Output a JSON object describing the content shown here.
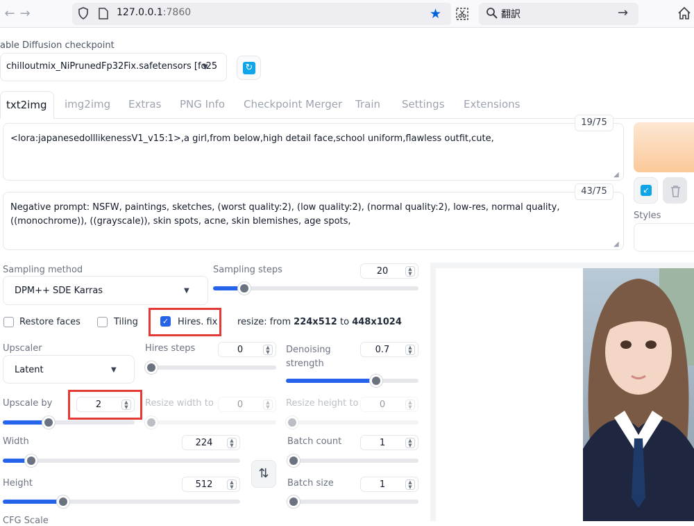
{
  "browser": {
    "url_host": "127.0.0.1",
    "url_port": ":7860",
    "search_text": "翻訳"
  },
  "checkpoint": {
    "label": "able Diffusion checkpoint",
    "value": "chilloutmix_NiPrunedFp32Fix.safetensors [fc25"
  },
  "tabs": [
    "txt2img",
    "img2img",
    "Extras",
    "PNG Info",
    "Checkpoint Merger",
    "Train",
    "Settings",
    "Extensions"
  ],
  "prompt": {
    "text": "<lora:japanesedolllikenessV1_v15:1>,a girl,from below,high detail face,school uniform,flawless outfit,cute,",
    "counter": "19/75"
  },
  "negative_prompt": {
    "text": "Negative prompt: NSFW, paintings, sketches, (worst quality:2), (low quality:2), (normal quality:2), low-res, normal quality, ((monochrome)), ((grayscale)), skin spots, acne, skin blemishes, age spots,",
    "counter": "43/75"
  },
  "styles_label": "Styles",
  "sampling": {
    "method_label": "Sampling method",
    "method_value": "DPM++ SDE Karras",
    "steps_label": "Sampling steps",
    "steps_value": "20",
    "steps_fraction": 0.13
  },
  "options": {
    "restore_faces": "Restore faces",
    "tiling": "Tiling",
    "hires_fix": "Hires. fix",
    "resize_prefix": "resize: from",
    "resize_from": "224x512",
    "resize_to_word": "to",
    "resize_to": "448x1024"
  },
  "hires": {
    "upscaler_label": "Upscaler",
    "upscaler_value": "Latent",
    "steps_label": "Hires steps",
    "steps_value": "0",
    "steps_fraction": 0.0,
    "denoise_label_1": "Denoising",
    "denoise_label_2": "strength",
    "denoise_value": "0.7",
    "denoise_fraction": 0.7,
    "upscale_label": "Upscale by",
    "upscale_value": "2",
    "upscale_fraction": 0.33,
    "resize_w_label": "Resize width to",
    "resize_w_value": "0",
    "resize_h_label": "Resize height to",
    "resize_h_value": "0"
  },
  "size": {
    "width_label": "Width",
    "width_value": "224",
    "width_fraction": 0.1,
    "height_label": "Height",
    "height_value": "512",
    "height_fraction": 0.24,
    "batch_count_label": "Batch count",
    "batch_count_value": "1",
    "batch_size_label": "Batch size",
    "batch_size_value": "1",
    "cfg_label": "CFG Scale"
  },
  "colors": {
    "accent": "#2563eb",
    "highlight": "#e53935",
    "generate_gradient_start": "#fde7d2",
    "generate_gradient_end": "#fbc99a"
  }
}
